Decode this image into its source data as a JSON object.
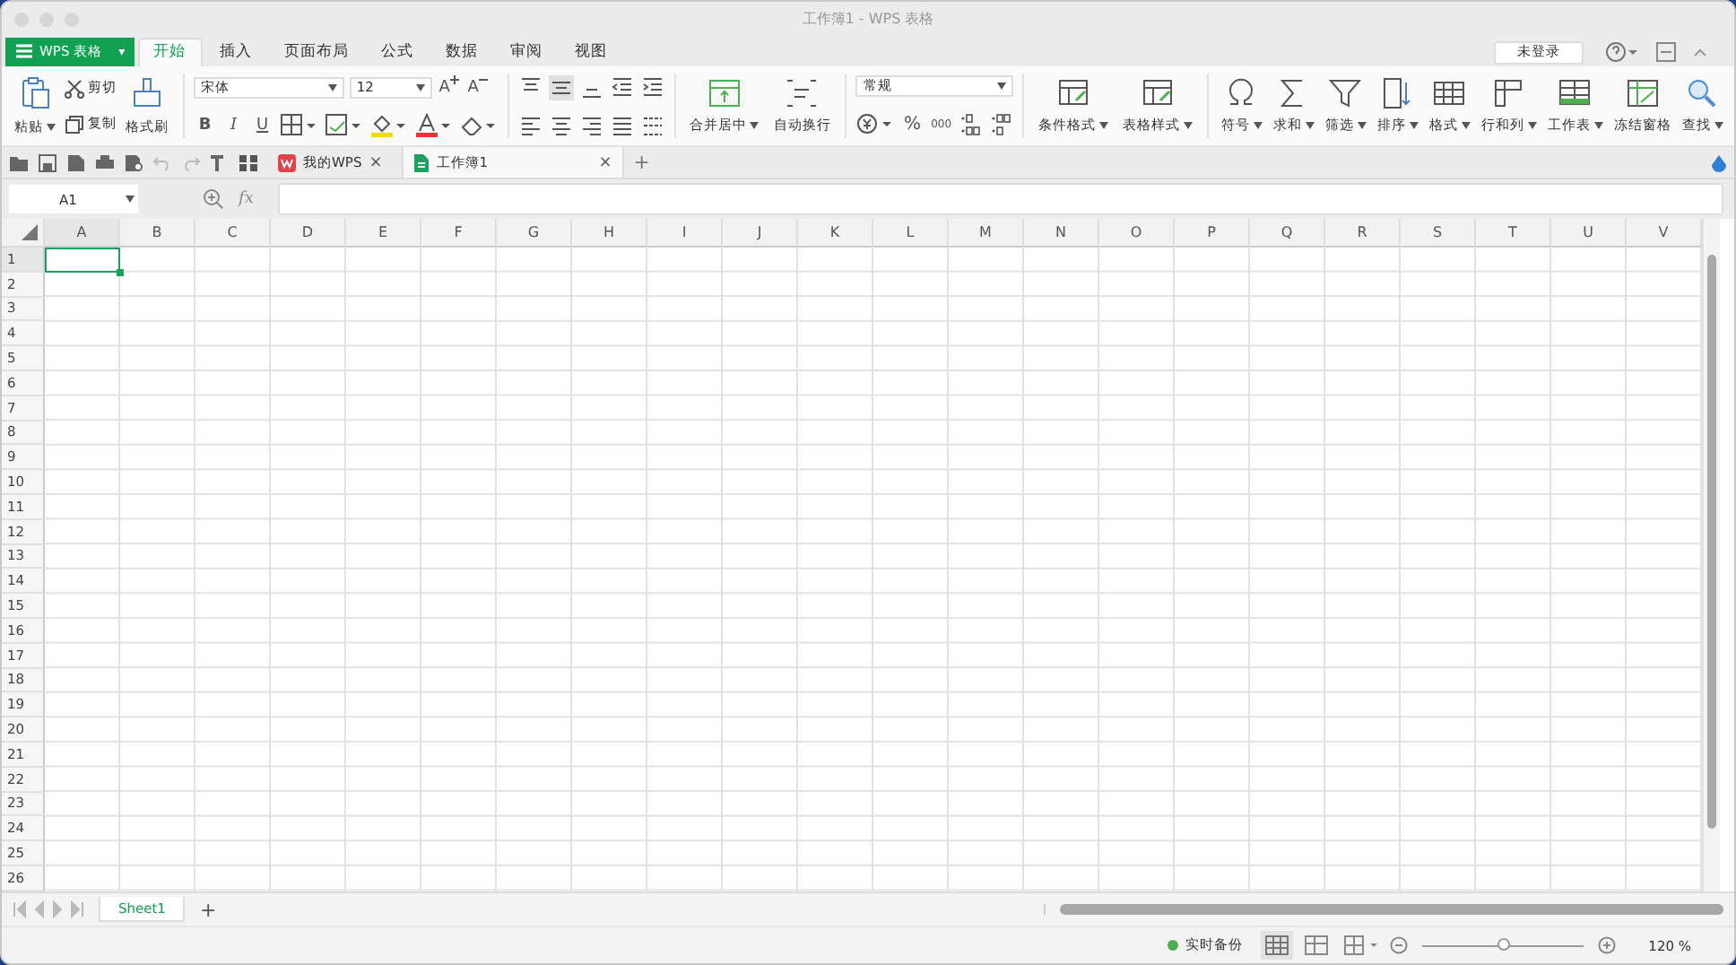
{
  "window": {
    "title": "工作簿1 - WPS 表格"
  },
  "app_button": {
    "label": "WPS 表格",
    "caret": "▾"
  },
  "menu_tabs": [
    {
      "label": "开始",
      "selected": true
    },
    {
      "label": "插入",
      "selected": false
    },
    {
      "label": "页面布局",
      "selected": false
    },
    {
      "label": "公式",
      "selected": false
    },
    {
      "label": "数据",
      "selected": false
    },
    {
      "label": "审阅",
      "selected": false
    },
    {
      "label": "视图",
      "selected": false
    }
  ],
  "login_button": {
    "label": "未登录"
  },
  "clipboard": {
    "paste": {
      "label": "粘贴",
      "dropdown": true
    },
    "cut": {
      "label": "剪切"
    },
    "copy": {
      "label": "复制"
    },
    "format_painter": {
      "label": "格式刷"
    }
  },
  "font": {
    "name": "宋体",
    "size": "12",
    "grow": "A",
    "shrink": "A",
    "style_buttons": [
      "B",
      "I",
      "U"
    ]
  },
  "merge_buttons": [
    {
      "label": "合并居中",
      "dropdown": true
    },
    {
      "label": "自动换行",
      "dropdown": false
    }
  ],
  "number": {
    "format": "常规",
    "percent": "%",
    "thousands": "000"
  },
  "style_buttons": [
    {
      "label": "条件格式",
      "dropdown": true
    },
    {
      "label": "表格样式",
      "dropdown": true
    }
  ],
  "tool_buttons": [
    {
      "label": "符号",
      "dropdown": true
    },
    {
      "label": "求和",
      "dropdown": true
    },
    {
      "label": "筛选",
      "dropdown": true
    },
    {
      "label": "排序",
      "dropdown": true
    },
    {
      "label": "格式",
      "dropdown": true
    },
    {
      "label": "行和列",
      "dropdown": true
    },
    {
      "label": "工作表",
      "dropdown": true
    },
    {
      "label": "冻结窗格",
      "dropdown": false
    },
    {
      "label": "查找",
      "dropdown": true
    }
  ],
  "doc_tabs": [
    {
      "label": "我的WPS",
      "kind": "home",
      "selected": false,
      "close": "×"
    },
    {
      "label": "工作簿1",
      "kind": "sheet",
      "selected": true,
      "close": "×"
    }
  ],
  "new_tab": "+",
  "formula_bar": {
    "name_box": "A1",
    "fx": "fx"
  },
  "columns": [
    "A",
    "B",
    "C",
    "D",
    "E",
    "F",
    "G",
    "H",
    "I",
    "J",
    "K",
    "L",
    "M",
    "N",
    "O",
    "P",
    "Q",
    "R",
    "S",
    "T",
    "U",
    "V"
  ],
  "rows": [
    "1",
    "2",
    "3",
    "4",
    "5",
    "6",
    "7",
    "8",
    "9",
    "10",
    "11",
    "12",
    "13",
    "14",
    "15",
    "16",
    "17",
    "18",
    "19",
    "20",
    "21",
    "22",
    "23",
    "24",
    "25",
    "26"
  ],
  "sheet_tabs": [
    {
      "label": "Sheet1",
      "selected": true
    }
  ],
  "add_sheet": "+",
  "status_bar": {
    "backup": "实时备份",
    "zoom": {
      "level": 0.5,
      "reading": "120 %"
    }
  }
}
